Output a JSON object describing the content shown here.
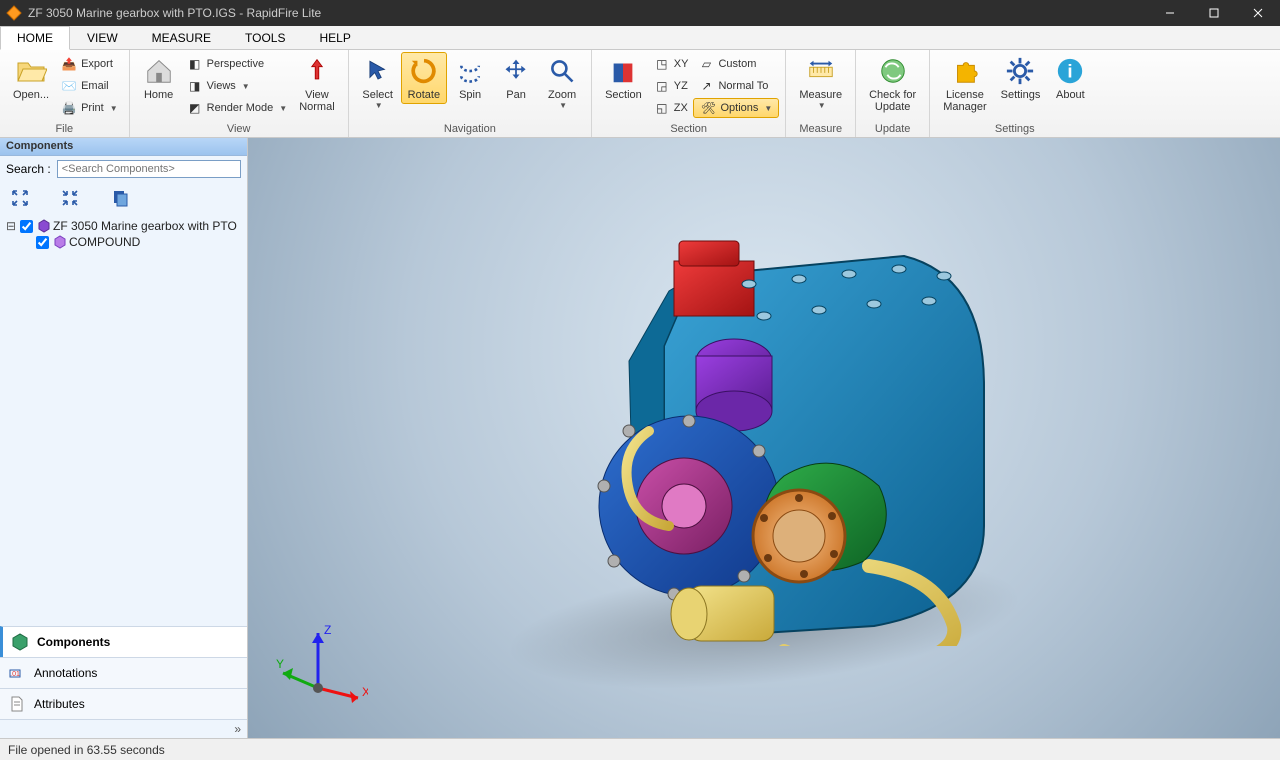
{
  "title": "ZF 3050 Marine gearbox with PTO.IGS - RapidFire Lite",
  "tabs": {
    "home": "HOME",
    "view": "VIEW",
    "measure": "MEASURE",
    "tools": "TOOLS",
    "help": "HELP"
  },
  "ribbon": {
    "file": {
      "title": "File",
      "open": "Open...",
      "export": "Export",
      "email": "Email",
      "print": "Print"
    },
    "view": {
      "title": "View",
      "home": "Home",
      "perspective": "Perspective",
      "views": "Views",
      "render": "Render Mode",
      "normal": "View\nNormal"
    },
    "nav": {
      "title": "Navigation",
      "select": "Select",
      "rotate": "Rotate",
      "spin": "Spin",
      "pan": "Pan",
      "zoom": "Zoom"
    },
    "section": {
      "title": "Section",
      "section": "Section",
      "xy": "XY",
      "yz": "YZ",
      "zx": "ZX",
      "custom": "Custom",
      "normalto": "Normal To",
      "options": "Options"
    },
    "measure": {
      "title": "Measure",
      "measure": "Measure"
    },
    "update": {
      "title": "Update",
      "check": "Check for\nUpdate"
    },
    "settings": {
      "title": "Settings",
      "license": "License\nManager",
      "settings": "Settings",
      "about": "About"
    }
  },
  "sidebar": {
    "header": "Components",
    "search_label": "Search :",
    "search_placeholder": "<Search Components>",
    "tree": {
      "root": "ZF 3050 Marine gearbox with PTO",
      "child": "COMPOUND"
    },
    "tabs": {
      "components": "Components",
      "annotations": "Annotations",
      "attributes": "Attributes"
    }
  },
  "axes": {
    "x": "X",
    "y": "Y",
    "z": "Z"
  },
  "status": "File opened in 63.55 seconds",
  "colors": {
    "accent": "#3b8fd8",
    "highlight": "#ffd76b"
  }
}
